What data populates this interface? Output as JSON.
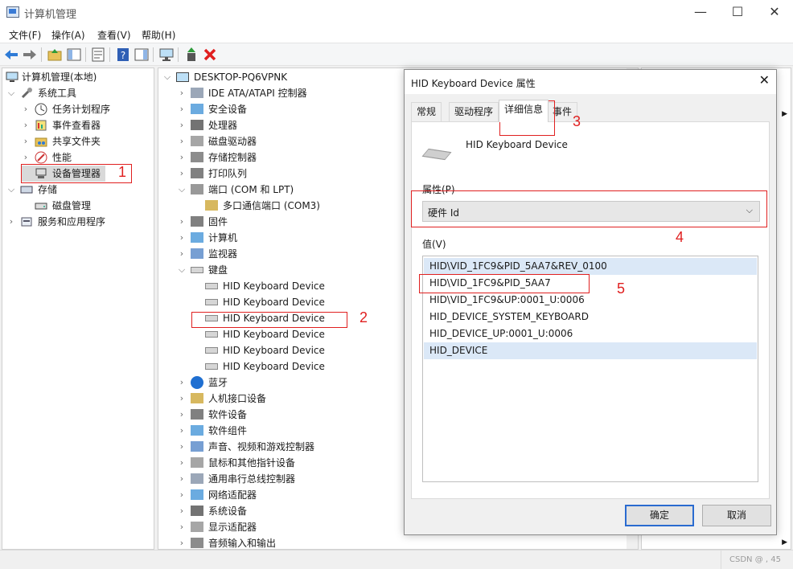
{
  "window": {
    "title": "计算机管理",
    "minimize": "—",
    "maximize": "☐",
    "close": "✕"
  },
  "menu": [
    "文件(F)",
    "操作(A)",
    "查看(V)",
    "帮助(H)"
  ],
  "left_tree": {
    "root": "计算机管理(本地)",
    "items": [
      {
        "label": "系统工具",
        "level": 1,
        "expanded": true
      },
      {
        "label": "任务计划程序",
        "level": 2
      },
      {
        "label": "事件查看器",
        "level": 2
      },
      {
        "label": "共享文件夹",
        "level": 2
      },
      {
        "label": "性能",
        "level": 2
      },
      {
        "label": "设备管理器",
        "level": 2,
        "selected": true
      },
      {
        "label": "存储",
        "level": 1,
        "expanded": true
      },
      {
        "label": "磁盘管理",
        "level": 2
      },
      {
        "label": "服务和应用程序",
        "level": 1
      }
    ]
  },
  "device_tree": {
    "root": "DESKTOP-PQ6VPNK",
    "items": [
      {
        "label": "IDE ATA/ATAPI 控制器",
        "level": 1
      },
      {
        "label": "安全设备",
        "level": 1
      },
      {
        "label": "处理器",
        "level": 1
      },
      {
        "label": "磁盘驱动器",
        "level": 1
      },
      {
        "label": "存储控制器",
        "level": 1
      },
      {
        "label": "打印队列",
        "level": 1
      },
      {
        "label": "端口 (COM 和 LPT)",
        "level": 1,
        "expanded": true
      },
      {
        "label": "多口通信端口 (COM3)",
        "level": 2
      },
      {
        "label": "固件",
        "level": 1
      },
      {
        "label": "计算机",
        "level": 1
      },
      {
        "label": "监视器",
        "level": 1
      },
      {
        "label": "键盘",
        "level": 1,
        "expanded": true
      },
      {
        "label": "HID Keyboard Device",
        "level": 2
      },
      {
        "label": "HID Keyboard Device",
        "level": 2
      },
      {
        "label": "HID Keyboard Device",
        "level": 2
      },
      {
        "label": "HID Keyboard Device",
        "level": 2
      },
      {
        "label": "HID Keyboard Device",
        "level": 2
      },
      {
        "label": "HID Keyboard Device",
        "level": 2
      },
      {
        "label": "蓝牙",
        "level": 1
      },
      {
        "label": "人机接口设备",
        "level": 1
      },
      {
        "label": "软件设备",
        "level": 1
      },
      {
        "label": "软件组件",
        "level": 1
      },
      {
        "label": "声音、视频和游戏控制器",
        "level": 1
      },
      {
        "label": "鼠标和其他指针设备",
        "level": 1
      },
      {
        "label": "通用串行总线控制器",
        "level": 1
      },
      {
        "label": "网络适配器",
        "level": 1
      },
      {
        "label": "系统设备",
        "level": 1
      },
      {
        "label": "显示适配器",
        "level": 1
      },
      {
        "label": "音频输入和输出",
        "level": 1
      }
    ]
  },
  "dialog": {
    "title": "HID Keyboard Device 属性",
    "close": "✕",
    "tabs": [
      "常规",
      "驱动程序",
      "详细信息",
      "事件"
    ],
    "active_tab": "详细信息",
    "device_name": "HID Keyboard Device",
    "property_label": "属性(P)",
    "property_value": "硬件 Id",
    "value_label": "值(V)",
    "values": [
      "HID\\VID_1FC9&PID_5AA7&REV_0100",
      "HID\\VID_1FC9&PID_5AA7",
      "HID\\VID_1FC9&UP:0001_U:0006",
      "HID_DEVICE_SYSTEM_KEYBOARD",
      "HID_DEVICE_UP:0001_U:0006",
      "HID_DEVICE"
    ],
    "ok": "确定",
    "cancel": "取消"
  },
  "annotations": [
    "1",
    "2",
    "3",
    "4",
    "5"
  ],
  "status": {
    "watermark": "CSDN @ , 45"
  },
  "colors": {
    "annotation_red": "#e02020",
    "selection": "#dbe8f7",
    "primary_border": "#2a6bd0"
  }
}
